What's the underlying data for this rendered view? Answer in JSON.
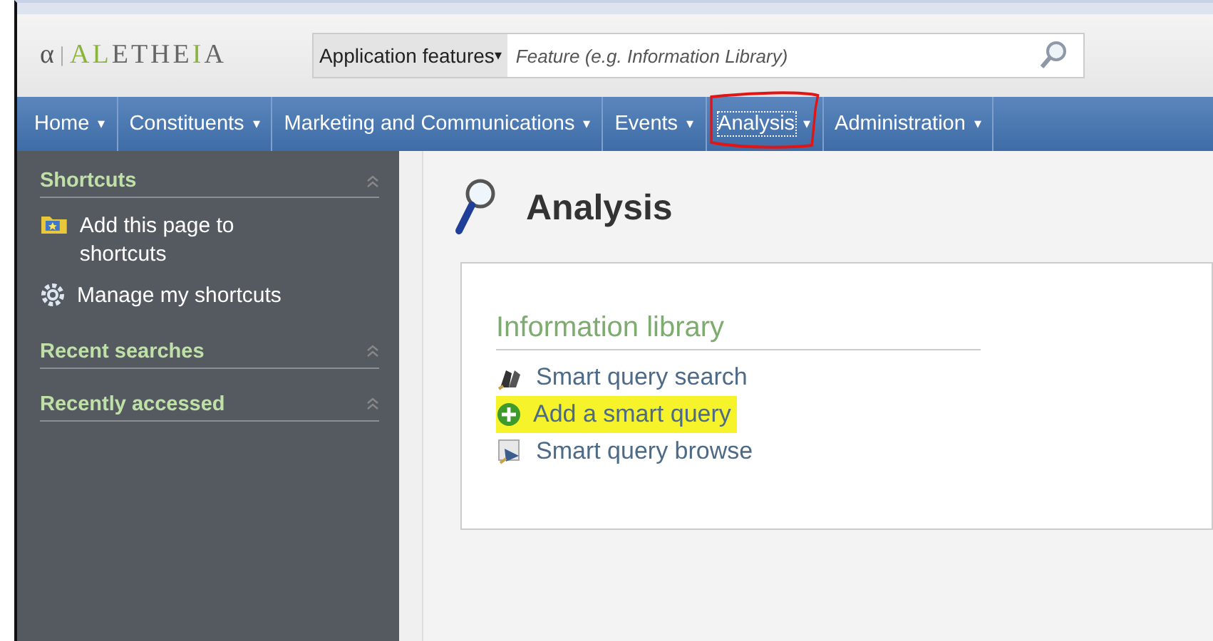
{
  "header": {
    "logo": {
      "mark": "α",
      "separator": "|",
      "name": "ALETHEIA"
    },
    "search": {
      "scope": "Application features",
      "caret": "▾",
      "placeholder": "Feature (e.g. Information Library)"
    }
  },
  "nav": {
    "items": [
      {
        "label": "Home",
        "caret": "▾",
        "selected": false
      },
      {
        "label": "Constituents",
        "caret": "▾",
        "selected": false
      },
      {
        "label": "Marketing and Communications",
        "caret": "▾",
        "selected": false
      },
      {
        "label": "Events",
        "caret": "▾",
        "selected": false
      },
      {
        "label": "Analysis",
        "caret": "▾",
        "selected": true
      },
      {
        "label": "Administration",
        "caret": "▾",
        "selected": false
      }
    ]
  },
  "sidebar": {
    "sections": [
      {
        "title": "Shortcuts",
        "items": [
          {
            "kind": "folder",
            "label": "Add this page to shortcuts"
          },
          {
            "kind": "gear",
            "label": "Manage my shortcuts"
          }
        ]
      },
      {
        "title": "Recent searches"
      },
      {
        "title": "Recently accessed"
      }
    ]
  },
  "page": {
    "title": "Analysis",
    "section": {
      "title": "Information library",
      "links": [
        {
          "kind": "search",
          "label": "Smart query search",
          "highlighted": false
        },
        {
          "kind": "add",
          "label": "Add a smart query",
          "highlighted": true
        },
        {
          "kind": "browse",
          "label": "Smart query browse",
          "highlighted": false
        }
      ]
    }
  }
}
